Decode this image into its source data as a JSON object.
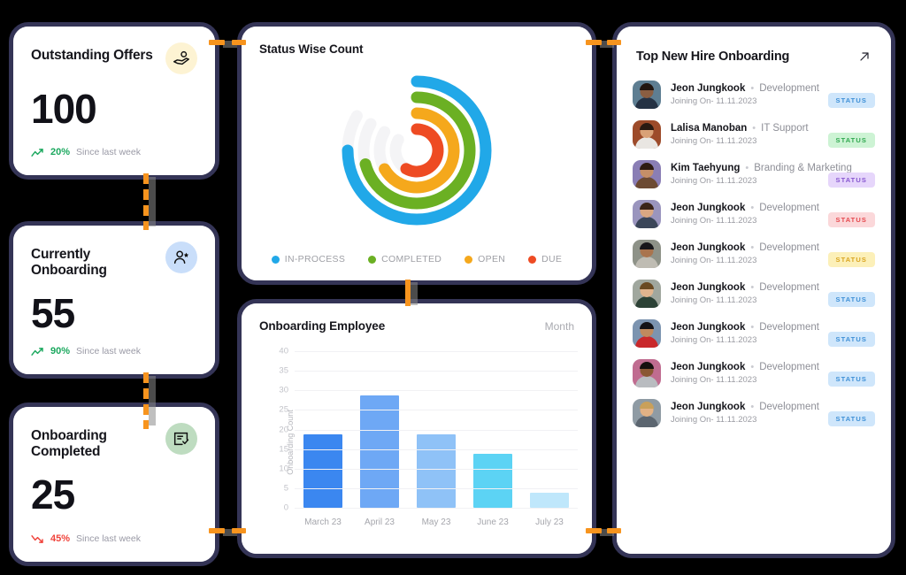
{
  "kpis": [
    {
      "title": "Outstanding Offers",
      "value": "100",
      "delta": "20%",
      "since": "Since last week",
      "direction": "up",
      "delta_color": "#1BA85E",
      "icon": "offer-hand-icon",
      "icon_bg": "#FDF3D3"
    },
    {
      "title": "Currently Onboarding",
      "value": "55",
      "delta": "90%",
      "since": "Since last week",
      "direction": "up",
      "delta_color": "#1BA85E",
      "icon": "user-star-icon",
      "icon_bg": "#C9DEFA"
    },
    {
      "title": "Onboarding Completed",
      "value": "25",
      "delta": "45%",
      "since": "Since last week",
      "direction": "down",
      "delta_color": "#F0433B",
      "icon": "checklist-icon",
      "icon_bg": "#BEDCC0"
    }
  ],
  "status_panel": {
    "title": "Status Wise Count"
  },
  "bar_panel": {
    "title": "Onboarding Employee",
    "period": "Month"
  },
  "list_panel": {
    "title": "Top New Hire Onboarding",
    "expand_icon": "arrow-up-right-icon",
    "joining_prefix": "Joining On-",
    "rows": [
      {
        "name": "Jeon Jungkook",
        "dept": "Development",
        "date": "11.11.2023",
        "badge": "STATUS",
        "badge_bg": "#CFE6FB",
        "badge_fg": "#3D8FD6",
        "av_bg": "#5E7E92",
        "av_skin": "#8A5E42",
        "av_hair": "#21150F",
        "av_body": "#253244"
      },
      {
        "name": "Lalisa Manoban",
        "dept": "IT Support",
        "date": "11.11.2023",
        "badge": "STATUS",
        "badge_bg": "#CDF3D4",
        "badge_fg": "#2FA84F",
        "av_bg": "#9D4B2A",
        "av_skin": "#D9A177",
        "av_hair": "#2A1A12",
        "av_body": "#E9E6E2"
      },
      {
        "name": "Kim Taehyung",
        "dept": "Branding & Marketing",
        "date": "11.11.2023",
        "badge": "STATUS",
        "badge_bg": "#E6D6FB",
        "badge_fg": "#8656CF",
        "av_bg": "#8A7EB5",
        "av_skin": "#C58F68",
        "av_hair": "#2E1B12",
        "av_body": "#6C4A33"
      },
      {
        "name": "Jeon Jungkook",
        "dept": "Development",
        "date": "11.11.2023",
        "badge": "STATUS",
        "badge_bg": "#FBD8DA",
        "badge_fg": "#E5484D",
        "av_bg": "#9A95BE",
        "av_skin": "#D9A782",
        "av_hair": "#3A2418",
        "av_body": "#3B4659"
      },
      {
        "name": "Jeon Jungkook",
        "dept": "Development",
        "date": "11.11.2023",
        "badge": "STATUS",
        "badge_bg": "#FCF0B9",
        "badge_fg": "#D9A420",
        "av_bg": "#8E9288",
        "av_skin": "#A9744E",
        "av_hair": "#17161A",
        "av_body": "#BFBCB3"
      },
      {
        "name": "Jeon Jungkook",
        "dept": "Development",
        "date": "11.11.2023",
        "badge": "STATUS",
        "badge_bg": "#CFE6FB",
        "badge_fg": "#3D8FD6",
        "av_bg": "#A0A79E",
        "av_skin": "#E0B48E",
        "av_hair": "#6A4A22",
        "av_body": "#2C4236"
      },
      {
        "name": "Jeon Jungkook",
        "dept": "Development",
        "date": "11.11.2023",
        "badge": "STATUS",
        "badge_bg": "#CFE6FB",
        "badge_fg": "#3D8FD6",
        "av_bg": "#7C94B0",
        "av_skin": "#C08A5E",
        "av_hair": "#141216",
        "av_body": "#C9282B"
      },
      {
        "name": "Jeon Jungkook",
        "dept": "Development",
        "date": "11.11.2023",
        "badge": "STATUS",
        "badge_bg": "#CFE6FB",
        "badge_fg": "#3D8FD6",
        "av_bg": "#C06C90",
        "av_skin": "#8A5834",
        "av_hair": "#15100E",
        "av_body": "#B9BCC0"
      },
      {
        "name": "Jeon Jungkook",
        "dept": "Development",
        "date": "11.11.2023",
        "badge": "STATUS",
        "badge_bg": "#CFE6FB",
        "badge_fg": "#3D8FD6",
        "av_bg": "#8F9BA4",
        "av_skin": "#E2B285",
        "av_hair": "#C9A05A",
        "av_body": "#5C6670"
      }
    ]
  },
  "chart_data": [
    {
      "type": "pie",
      "title": "Status Wise Count",
      "render": "radial-bar",
      "legend_position": "bottom",
      "categories": [
        "IN-PROCESS",
        "COMPLETED",
        "OPEN",
        "DUE"
      ],
      "values": [
        75,
        71,
        67,
        58
      ],
      "unit": "percent-of-ring",
      "sweep_degrees": [
        270,
        255,
        240,
        210
      ],
      "colors": [
        "#21A8E8",
        "#6BB023",
        "#F5A81C",
        "#EE4B23"
      ],
      "track_color": "#F4F4F6"
    },
    {
      "type": "bar",
      "title": "Onboarding Employee",
      "period": "Month",
      "categories": [
        "March 23",
        "April 23",
        "May 23",
        "June 23",
        "July 23"
      ],
      "values": [
        18.7,
        28.7,
        18.7,
        13.7,
        3.9
      ],
      "colors": [
        "#3B87F0",
        "#6EA8F5",
        "#8FC2F7",
        "#5CD3F4",
        "#BFE7FB"
      ],
      "xlabel": "",
      "ylabel": "Onboarding Count",
      "ylim": [
        0,
        40
      ],
      "yticks": [
        0,
        5,
        10,
        15,
        20,
        25,
        30,
        35,
        40
      ],
      "grid": true
    }
  ]
}
